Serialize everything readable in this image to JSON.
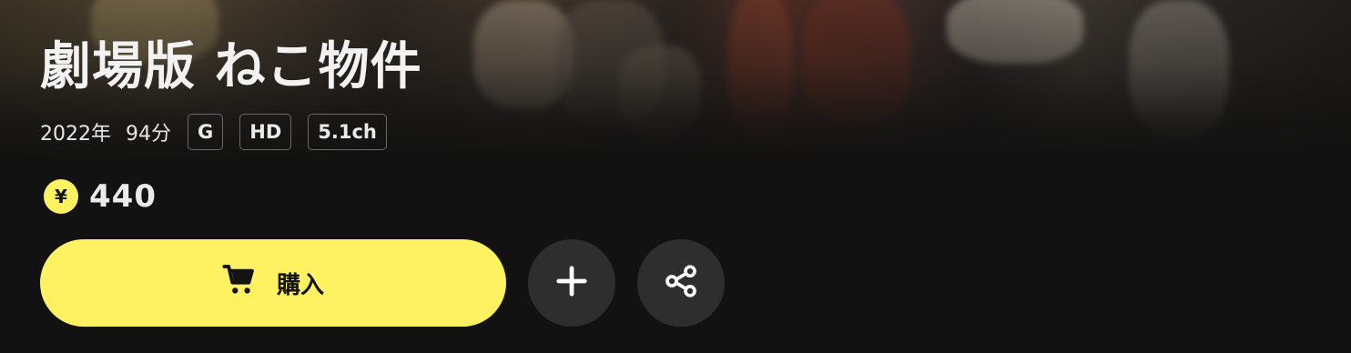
{
  "title": "劇場版 ねこ物件",
  "meta": {
    "year": "2022年",
    "duration": "94分",
    "badges": [
      "G",
      "HD",
      "5.1ch"
    ]
  },
  "price": {
    "currency_symbol": "¥",
    "value": "440"
  },
  "actions": {
    "buy_label": "購入",
    "buy_icon": "cart-icon",
    "add_icon": "plus-icon",
    "share_icon": "share-icon"
  },
  "colors": {
    "accent": "#fef263",
    "background": "#121212",
    "round_button": "#2e2e2e"
  }
}
